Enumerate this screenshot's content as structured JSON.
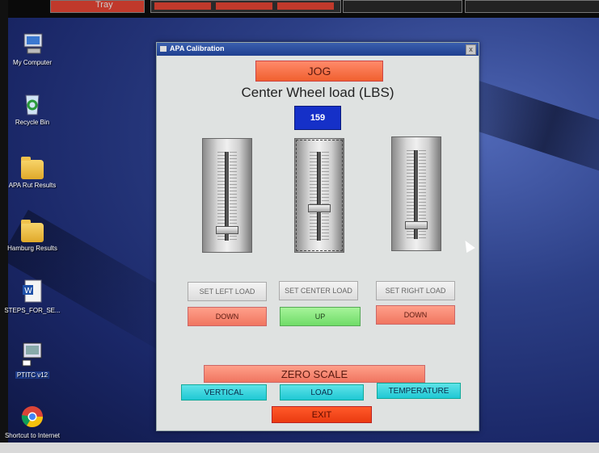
{
  "taskbar": {
    "tray_label": "Tray"
  },
  "desktop_icons": [
    {
      "label": "My Computer"
    },
    {
      "label": "Recycle Bin"
    },
    {
      "label": "APA Rut Results"
    },
    {
      "label": "Hamburg Results"
    },
    {
      "label": "STEPS_FOR_SE..."
    },
    {
      "label": "PTITC v12"
    },
    {
      "label": "Shortcut to Internet"
    }
  ],
  "window": {
    "title": "APA Calibration",
    "close_glyph": "x",
    "jog_label": "JOG",
    "heading": "Center Wheel load (LBS)",
    "readout_value": "159",
    "sliders": [
      {
        "name": "left",
        "level": 0.08
      },
      {
        "name": "center",
        "level": 0.35
      },
      {
        "name": "right",
        "level": 0.12
      }
    ],
    "set_left_label": "SET LEFT LOAD",
    "set_center_label": "SET CENTER LOAD",
    "set_right_label": "SET RIGHT LOAD",
    "left_down_label": "DOWN",
    "center_up_label": "UP",
    "right_down_label": "DOWN",
    "zero_scale_label": "ZERO SCALE",
    "vertical_label": "VERTICAL",
    "load_label": "LOAD",
    "temperature_label": "TEMPERATURE",
    "exit_label": "EXIT"
  },
  "colors": {
    "jog": "#f0602f",
    "readout": "#1530c8",
    "up": "#70dc68",
    "down": "#f07560",
    "cyan": "#1fc8d4",
    "exit": "#ea3a10"
  }
}
